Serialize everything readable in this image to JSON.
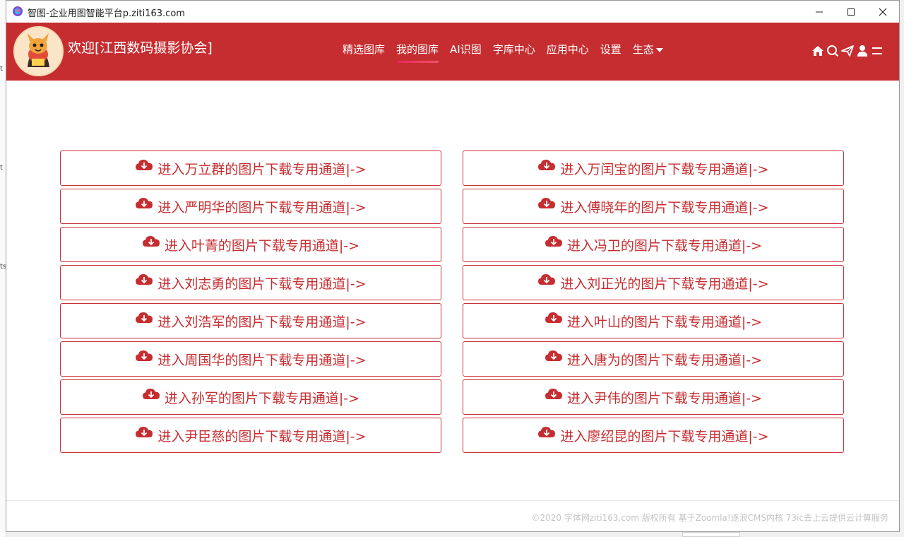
{
  "window": {
    "title": "智图-企业用图智能平台p.ziti163.com",
    "minimize_icon": "minimize-icon",
    "maximize_icon": "maximize-icon",
    "close_icon": "close-icon"
  },
  "header": {
    "welcome": "欢迎[江西数码摄影协会]",
    "menu": [
      {
        "label": "精选图库"
      },
      {
        "label": "我的图库",
        "active": true
      },
      {
        "label": "AI识图"
      },
      {
        "label": "字库中心"
      },
      {
        "label": "应用中心"
      },
      {
        "label": "设置"
      },
      {
        "label": "生态",
        "dropdown": true
      }
    ],
    "icons": [
      "home-icon",
      "search-icon",
      "send-icon",
      "user-icon",
      "menu-icon"
    ]
  },
  "channels": [
    "进入万立群的图片下载专用通道|->",
    "进入万闰宝的图片下载专用通道|->",
    "进入严明华的图片下载专用通道|->",
    "进入傅晓年的图片下载专用通道|->",
    "进入叶菁的图片下载专用通道|->",
    "进入冯卫的图片下载专用通道|->",
    "进入刘志勇的图片下载专用通道|->",
    "进入刘正光的图片下载专用通道|->",
    "进入刘浩军的图片下载专用通道|->",
    "进入叶山的图片下载专用通道|->",
    "进入周国华的图片下载专用通道|->",
    "进入唐为的图片下载专用通道|->",
    "进入孙军的图片下载专用通道|->",
    "进入尹伟的图片下载专用通道|->",
    "进入尹臣慈的图片下载专用通道|->",
    "进入廖绍昆的图片下载专用通道|->"
  ],
  "footer": {
    "text": "©2020 字体网ziti163.com 版权所有 基于Zoomla!逐浪CMS内核 73ic去上云提供云计算服务"
  },
  "colors": {
    "brand_red": "#c62d30",
    "active_underline": "#e9285f",
    "footer_text": "#c3c3c3"
  }
}
